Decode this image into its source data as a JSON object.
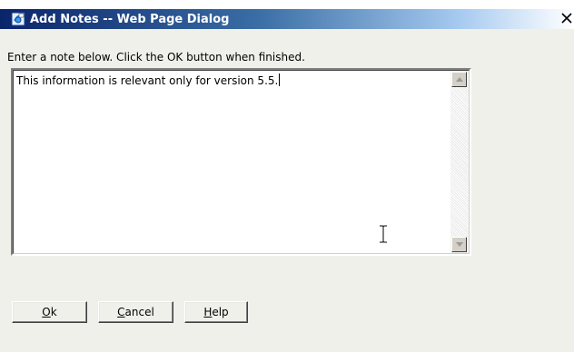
{
  "window": {
    "title": "Add Notes -- Web Page Dialog",
    "title_icon": "ie-page-icon",
    "close_glyph": "✕"
  },
  "instruction": "Enter a note below. Click the OK button when finished.",
  "note": {
    "value": "This information is relevant only for version 5.5."
  },
  "buttons": {
    "ok": {
      "mnemonic": "O",
      "rest": "k"
    },
    "cancel": {
      "mnemonic": "C",
      "rest": "ancel"
    },
    "help": {
      "mnemonic": "H",
      "rest": "elp"
    }
  },
  "colors": {
    "titlebar_start": "#0a246a",
    "titlebar_end": "#a6caf0",
    "dialog_bg": "#f0f0eb"
  }
}
